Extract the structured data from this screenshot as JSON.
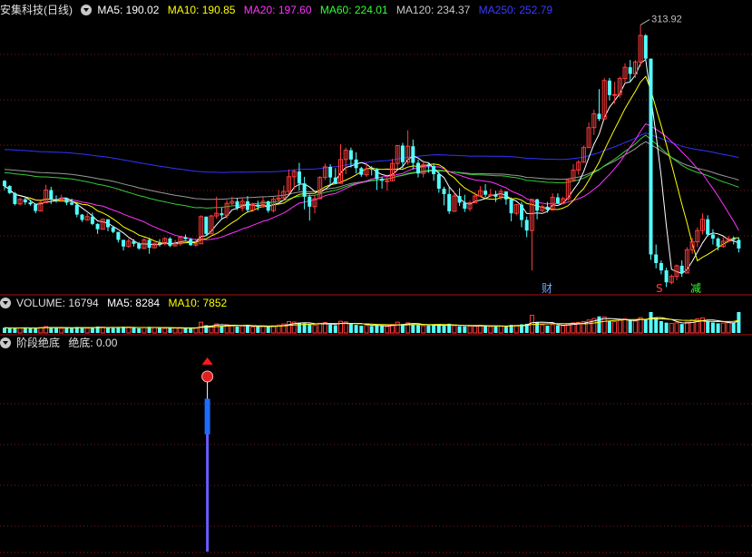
{
  "header": {
    "stock_title": "安集科技(日线)",
    "ma5": "MA5: 190.02",
    "ma10": "MA10: 190.85",
    "ma20": "MA20: 197.60",
    "ma60": "MA60: 224.01",
    "ma120": "MA120: 234.37",
    "ma250": "MA250: 252.79"
  },
  "volume_header": {
    "title": "VOLUME: 16794",
    "ma5": "MA5: 8284",
    "ma10": "MA10: 7852"
  },
  "indicator_header": {
    "title": "阶段绝底",
    "value": "绝底: 0.00"
  },
  "markers": {
    "cai": "财",
    "s": "S",
    "jian": "减"
  },
  "colors": {
    "up": "#ff3c3c",
    "down": "#54ffff",
    "ma5": "#ffffff",
    "ma10": "#ffff00",
    "ma20": "#ff33ff",
    "ma60": "#33cc33",
    "ma120": "#999999",
    "ma250": "#3333ff"
  },
  "chart_data": {
    "type": "candlestick",
    "title": "安集科技(日线)",
    "y_range": [
      154,
      318
    ],
    "max_label": "313.92",
    "max_index": 123,
    "candles": [
      [
        220.0,
        220.0,
        216.8,
        214.4,
        220.4
      ],
      [
        216.8,
        216.8,
        212.6,
        212.0,
        217.4
      ],
      [
        212.6,
        212.6,
        206.0,
        205.2,
        213.2
      ],
      [
        206.0,
        206.0,
        208.8,
        205.2,
        209.6
      ],
      [
        208.8,
        208.8,
        207.0,
        205.6,
        210.4
      ],
      [
        207.0,
        207.0,
        205.8,
        205.0,
        208.6
      ],
      [
        205.8,
        205.8,
        201.8,
        200.4,
        205.8
      ],
      [
        201.8,
        201.8,
        206.8,
        201.8,
        208.0
      ],
      [
        206.8,
        206.8,
        214.4,
        206.8,
        217.6
      ],
      [
        214.4,
        214.4,
        208.8,
        206.0,
        216.4
      ],
      [
        208.8,
        208.8,
        208.4,
        206.8,
        211.2
      ],
      [
        208.4,
        208.4,
        209.6,
        207.6,
        211.6
      ],
      [
        209.6,
        209.6,
        206.8,
        205.2,
        209.6
      ],
      [
        206.8,
        206.8,
        205.6,
        205.2,
        209.2
      ],
      [
        205.6,
        205.6,
        199.6,
        198.0,
        206.4
      ],
      [
        199.6,
        199.6,
        196.4,
        195.2,
        200.0
      ],
      [
        196.4,
        196.4,
        198.4,
        196.0,
        200.4
      ],
      [
        198.4,
        198.4,
        194.0,
        193.2,
        200.8
      ],
      [
        194.0,
        194.0,
        190.8,
        188.0,
        194.4
      ],
      [
        190.8,
        190.8,
        196.8,
        190.8,
        197.2
      ],
      [
        196.8,
        196.8,
        192.0,
        189.6,
        196.8
      ],
      [
        192.0,
        192.0,
        189.2,
        188.4,
        192.8
      ],
      [
        189.2,
        189.2,
        184.4,
        182.8,
        189.2
      ],
      [
        184.4,
        184.4,
        180.4,
        178.0,
        184.4
      ],
      [
        180.4,
        180.4,
        183.6,
        179.6,
        185.2
      ],
      [
        183.6,
        183.6,
        182.0,
        180.4,
        184.8
      ],
      [
        182.0,
        182.0,
        179.2,
        178.4,
        183.2
      ],
      [
        179.2,
        179.2,
        184.4,
        179.2,
        185.6
      ],
      [
        184.4,
        184.4,
        179.6,
        176.0,
        185.6
      ],
      [
        179.6,
        179.6,
        182.4,
        179.6,
        182.8
      ],
      [
        182.4,
        182.4,
        182.0,
        180.4,
        184.8
      ],
      [
        182.0,
        182.0,
        185.2,
        181.2,
        186.0
      ],
      [
        185.2,
        185.2,
        180.8,
        180.0,
        186.0
      ],
      [
        180.8,
        180.8,
        182.0,
        180.4,
        184.4
      ],
      [
        182.0,
        182.0,
        186.0,
        180.8,
        186.4
      ],
      [
        186.0,
        186.0,
        184.8,
        184.4,
        187.6
      ],
      [
        184.8,
        184.8,
        181.2,
        180.8,
        185.6
      ],
      [
        181.2,
        181.2,
        182.0,
        180.4,
        185.2
      ],
      [
        182.0,
        182.0,
        198.4,
        182.0,
        199.2
      ],
      [
        198.4,
        198.4,
        188.0,
        186.8,
        198.4
      ],
      [
        188.0,
        188.0,
        198.8,
        188.0,
        199.6
      ],
      [
        198.8,
        198.8,
        200.4,
        197.2,
        210.4
      ],
      [
        200.4,
        200.4,
        199.2,
        197.2,
        204.0
      ],
      [
        199.2,
        199.2,
        206.4,
        197.2,
        208.4
      ],
      [
        206.4,
        206.4,
        207.6,
        205.2,
        210.4
      ],
      [
        207.6,
        207.6,
        203.6,
        202.4,
        209.6
      ],
      [
        203.6,
        203.6,
        207.6,
        201.6,
        210.0
      ],
      [
        207.6,
        207.6,
        202.4,
        200.8,
        210.8
      ],
      [
        202.4,
        202.4,
        205.6,
        202.4,
        206.8
      ],
      [
        205.6,
        205.6,
        204.4,
        202.0,
        208.0
      ],
      [
        204.4,
        204.4,
        207.6,
        203.6,
        210.0
      ],
      [
        207.6,
        207.6,
        202.0,
        200.8,
        208.0
      ],
      [
        202.0,
        202.0,
        208.8,
        200.8,
        210.4
      ],
      [
        208.8,
        208.8,
        209.6,
        207.2,
        214.4
      ],
      [
        209.6,
        209.6,
        213.6,
        208.0,
        217.2
      ],
      [
        213.6,
        213.6,
        222.4,
        212.0,
        226.8
      ],
      [
        222.4,
        222.4,
        225.6,
        214.8,
        226.8
      ],
      [
        225.6,
        225.6,
        218.4,
        214.0,
        230.8
      ],
      [
        218.4,
        218.4,
        210.4,
        202.8,
        222.4
      ],
      [
        210.4,
        210.4,
        204.4,
        196.0,
        211.6
      ],
      [
        204.4,
        204.4,
        209.2,
        200.4,
        211.2
      ],
      [
        209.2,
        209.2,
        222.0,
        208.8,
        222.8
      ],
      [
        222.0,
        222.0,
        228.4,
        220.4,
        230.4
      ],
      [
        228.4,
        228.4,
        222.0,
        216.8,
        230.0
      ],
      [
        222.0,
        222.0,
        218.4,
        218.4,
        227.6
      ],
      [
        218.4,
        218.4,
        232.8,
        218.4,
        242.0
      ],
      [
        232.8,
        232.8,
        238.4,
        224.0,
        240.0
      ],
      [
        238.4,
        238.4,
        232.8,
        228.0,
        240.0
      ],
      [
        232.8,
        232.8,
        227.6,
        224.4,
        237.2
      ],
      [
        227.6,
        227.6,
        223.6,
        222.4,
        228.4
      ],
      [
        223.6,
        223.6,
        227.2,
        222.4,
        230.8
      ],
      [
        227.2,
        227.2,
        226.8,
        223.2,
        228.8
      ],
      [
        226.8,
        226.8,
        221.2,
        214.4,
        227.6
      ],
      [
        221.2,
        221.2,
        220.0,
        215.2,
        222.4
      ],
      [
        220.0,
        220.0,
        220.0,
        214.0,
        223.6
      ],
      [
        220.0,
        220.0,
        230.4,
        219.6,
        233.2
      ],
      [
        230.4,
        230.4,
        241.2,
        227.2,
        241.2
      ],
      [
        241.2,
        241.2,
        231.2,
        227.6,
        242.8
      ],
      [
        231.2,
        231.2,
        240.8,
        229.6,
        250.4
      ],
      [
        240.8,
        240.8,
        230.8,
        226.8,
        244.8
      ],
      [
        230.8,
        230.8,
        224.4,
        222.0,
        232.8
      ],
      [
        224.4,
        224.4,
        229.6,
        222.0,
        232.4
      ],
      [
        229.6,
        229.6,
        228.8,
        224.8,
        230.8
      ],
      [
        228.8,
        228.8,
        224.0,
        220.0,
        230.0
      ],
      [
        224.0,
        224.0,
        215.2,
        212.8,
        225.6
      ],
      [
        215.2,
        215.2,
        212.0,
        205.2,
        216.4
      ],
      [
        212.0,
        212.0,
        201.6,
        200.0,
        216.4
      ],
      [
        201.6,
        201.6,
        210.8,
        201.2,
        212.8
      ],
      [
        210.8,
        210.8,
        206.8,
        204.8,
        215.6
      ],
      [
        206.8,
        206.8,
        203.2,
        201.2,
        211.6
      ],
      [
        203.2,
        203.2,
        206.8,
        201.6,
        208.0
      ],
      [
        206.8,
        206.8,
        210.8,
        206.8,
        213.2
      ],
      [
        210.8,
        210.8,
        214.0,
        210.4,
        216.8
      ],
      [
        214.0,
        214.0,
        211.6,
        210.0,
        218.0
      ],
      [
        211.6,
        211.6,
        211.6,
        210.4,
        215.2
      ],
      [
        211.6,
        211.6,
        210.4,
        207.2,
        214.0
      ],
      [
        210.4,
        210.4,
        213.6,
        208.4,
        215.2
      ],
      [
        213.6,
        213.6,
        208.8,
        205.6,
        213.6
      ],
      [
        208.8,
        208.8,
        200.4,
        195.6,
        210.0
      ],
      [
        200.4,
        200.4,
        205.6,
        199.2,
        206.0
      ],
      [
        205.6,
        205.6,
        196.4,
        192.0,
        207.2
      ],
      [
        196.4,
        196.4,
        190.0,
        186.0,
        198.4
      ],
      [
        190.0,
        190.0,
        208.8,
        166.0,
        209.2
      ],
      [
        208.8,
        208.8,
        202.0,
        196.8,
        209.2
      ],
      [
        202.0,
        202.0,
        204.4,
        201.2,
        205.6
      ],
      [
        204.4,
        204.4,
        202.4,
        200.8,
        207.2
      ],
      [
        202.4,
        202.4,
        210.0,
        202.4,
        212.4
      ],
      [
        210.0,
        210.0,
        206.4,
        206.0,
        212.4
      ],
      [
        206.4,
        206.4,
        209.2,
        205.6,
        210.4
      ],
      [
        209.2,
        209.2,
        220.4,
        208.0,
        221.6
      ],
      [
        220.4,
        220.4,
        226.4,
        220.0,
        230.0
      ],
      [
        226.4,
        226.4,
        231.2,
        223.6,
        232.4
      ],
      [
        231.2,
        231.2,
        240.0,
        230.8,
        241.2
      ],
      [
        240.0,
        240.0,
        252.0,
        240.0,
        255.2
      ],
      [
        252.0,
        252.0,
        260.4,
        247.6,
        262.8
      ],
      [
        260.4,
        260.4,
        257.2,
        256.0,
        275.2
      ],
      [
        257.2,
        257.2,
        280.4,
        256.8,
        282.0
      ],
      [
        280.4,
        280.4,
        271.6,
        268.4,
        282.0
      ],
      [
        271.6,
        271.6,
        272.0,
        266.4,
        279.6
      ],
      [
        272.0,
        272.0,
        281.6,
        270.0,
        282.8
      ],
      [
        281.6,
        281.6,
        288.4,
        278.8,
        290.8
      ],
      [
        288.4,
        288.4,
        284.4,
        280.0,
        292.8
      ],
      [
        284.4,
        284.4,
        291.6,
        282.0,
        292.8
      ],
      [
        291.6,
        291.6,
        307.6,
        288.8,
        313.9
      ],
      [
        307.6,
        307.6,
        293.6,
        292.0,
        308.4
      ],
      [
        293.6,
        293.6,
        175.6,
        172.4,
        293.6
      ],
      [
        175.6,
        175.6,
        170.4,
        167.2,
        181.6
      ],
      [
        170.4,
        170.4,
        166.0,
        163.6,
        172.0
      ],
      [
        166.0,
        166.0,
        158.8,
        156.0,
        167.6
      ],
      [
        158.8,
        158.8,
        162.4,
        157.6,
        163.6
      ],
      [
        162.4,
        162.4,
        168.8,
        160.0,
        169.6
      ],
      [
        168.8,
        168.8,
        164.4,
        162.0,
        172.0
      ],
      [
        164.4,
        164.4,
        178.4,
        164.4,
        180.0
      ],
      [
        178.4,
        178.4,
        183.2,
        176.0,
        185.6
      ],
      [
        183.2,
        183.2,
        190.0,
        180.0,
        192.0
      ],
      [
        190.0,
        190.0,
        196.8,
        187.6,
        200.4
      ],
      [
        196.8,
        196.8,
        187.6,
        186.4,
        199.2
      ],
      [
        187.6,
        187.6,
        185.2,
        181.6,
        190.8
      ],
      [
        185.2,
        185.2,
        180.4,
        178.0,
        186.0
      ],
      [
        180.4,
        180.4,
        183.6,
        179.6,
        186.0
      ],
      [
        183.6,
        183.6,
        185.2,
        182.8,
        186.8
      ],
      [
        185.2,
        185.2,
        184.4,
        181.6,
        186.4
      ],
      [
        184.4,
        184.4,
        179.2,
        176.8,
        186.0
      ]
    ],
    "volume": {
      "header_value": 16794,
      "ma5": 8284,
      "ma10": 7852,
      "values": [
        4200,
        3800,
        4100,
        3900,
        4300,
        4000,
        3600,
        4400,
        5200,
        4700,
        4000,
        3700,
        4100,
        3900,
        4800,
        4500,
        3800,
        4300,
        5100,
        4600,
        4200,
        3900,
        4400,
        5000,
        4700,
        4100,
        3800,
        4300,
        4900,
        4400,
        4000,
        3700,
        4200,
        3900,
        4100,
        3800,
        3600,
        4000,
        8600,
        6200,
        5400,
        7300,
        5800,
        6600,
        6100,
        5200,
        5600,
        5900,
        4800,
        5100,
        5300,
        5000,
        5700,
        6400,
        7200,
        9100,
        8800,
        8200,
        7600,
        6900,
        6100,
        7800,
        8400,
        6700,
        6200,
        9400,
        8900,
        7300,
        6500,
        5800,
        6000,
        5600,
        6300,
        5500,
        5200,
        6800,
        8700,
        7200,
        8100,
        7000,
        6300,
        5800,
        6100,
        5900,
        6600,
        5700,
        7400,
        5900,
        5500,
        5300,
        5400,
        5800,
        6200,
        5600,
        5100,
        5300,
        5700,
        5500,
        6500,
        6100,
        6900,
        7300,
        14200,
        8600,
        6500,
        5900,
        6700,
        6200,
        5800,
        7400,
        8100,
        8500,
        9200,
        10400,
        11600,
        13300,
        12800,
        9800,
        9100,
        10200,
        11400,
        10100,
        9600,
        12400,
        10700,
        16800,
        12400,
        9500,
        8300,
        7600,
        8100,
        7200,
        8800,
        10400,
        11300,
        12100,
        9700,
        8400,
        7700,
        8000,
        8200,
        7900,
        16794
      ]
    },
    "indicator": {
      "name": "阶段绝底",
      "value_label": "绝底: 0.00",
      "signal_index": 38,
      "signal_blue_range": [
        0.42,
        0.63
      ]
    }
  }
}
